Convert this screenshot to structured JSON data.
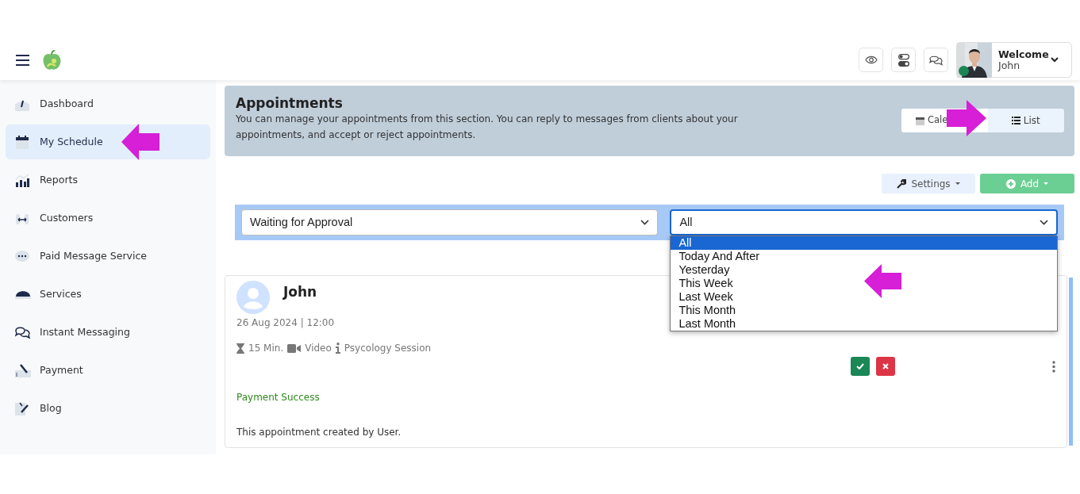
{
  "header": {
    "welcome": "Welcome",
    "user": "John",
    "online": true
  },
  "sidebar": {
    "items": [
      {
        "label": "Dashboard",
        "selected": false
      },
      {
        "label": "My Schedule",
        "selected": true
      },
      {
        "label": "Reports",
        "selected": false
      },
      {
        "label": "Customers",
        "selected": false
      },
      {
        "label": "Paid Message Service",
        "selected": false
      },
      {
        "label": "Services",
        "selected": false
      },
      {
        "label": "Instant Messaging",
        "selected": false
      },
      {
        "label": "Payment",
        "selected": false
      },
      {
        "label": "Blog",
        "selected": false
      }
    ]
  },
  "page": {
    "title": "Appointments",
    "description": "You can manage your appointments from this section. You can reply to messages from clients about your appointments, and accept or reject appointments."
  },
  "view_toggle": [
    {
      "label": "Cale",
      "selected": false
    },
    {
      "label": "List",
      "selected": true
    }
  ],
  "toolbar": {
    "settings": "Settings",
    "add": "Add"
  },
  "filters": [
    {
      "value": "Waiting for Approval",
      "open": false
    },
    {
      "value": "All",
      "open": true,
      "options": [
        {
          "label": "All",
          "selected": true
        },
        {
          "label": "Today And After",
          "selected": false
        },
        {
          "label": "Yesterday",
          "selected": false
        },
        {
          "label": "This Week",
          "selected": false
        },
        {
          "label": "Last Week",
          "selected": false
        },
        {
          "label": "This Month",
          "selected": false
        },
        {
          "label": "Last Month",
          "selected": false
        }
      ]
    }
  ],
  "appointment": {
    "name": "John",
    "datetime": "26 Aug 2024 | 12:00",
    "duration": "15 Min.",
    "type": "Video",
    "service": "Psycology Session",
    "payment": "Payment Success",
    "note": "This appointment created by User."
  }
}
